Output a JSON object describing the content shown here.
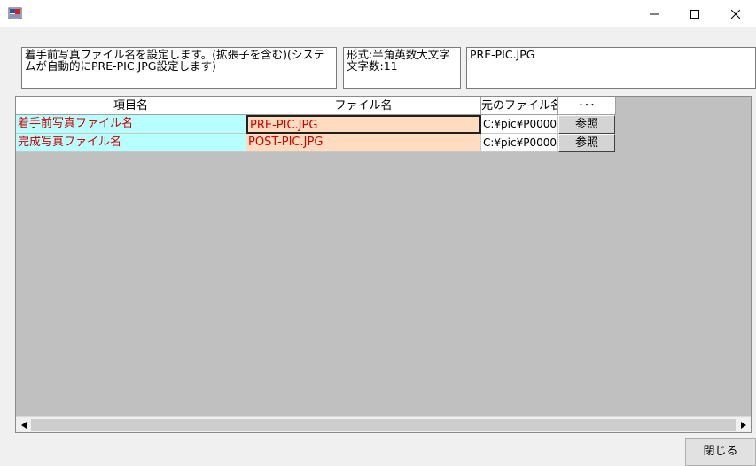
{
  "window": {
    "icon": "app-icon",
    "controls": [
      "minimize-icon",
      "maximize-icon",
      "close-icon"
    ]
  },
  "info": {
    "description": "着手前写真ファイル名を設定します。(拡張子を含む)(システムが自動的にPRE-PIC.JPG設定します)",
    "format": "形式:半角英数大文字\n文字数:11",
    "value": "PRE-PIC.JPG"
  },
  "grid": {
    "headers": [
      "項目名",
      "ファイル名",
      "元のファイル名",
      "･･･"
    ],
    "rows": [
      {
        "item": "着手前写真ファイル名",
        "file": "PRE-PIC.JPG",
        "original": "C:¥pic¥P0000",
        "button": "参照"
      },
      {
        "item": "完成写真ファイル名",
        "file": "POST-PIC.JPG",
        "original": "C:¥pic¥P0000",
        "button": "参照"
      }
    ]
  },
  "footer": {
    "close_label": "閉じる"
  },
  "colors": {
    "item_bg": "#b8ffff",
    "file_bg": "#ffdcbf",
    "text_red": "#d00000",
    "grid_bg": "#c0c0c0"
  }
}
